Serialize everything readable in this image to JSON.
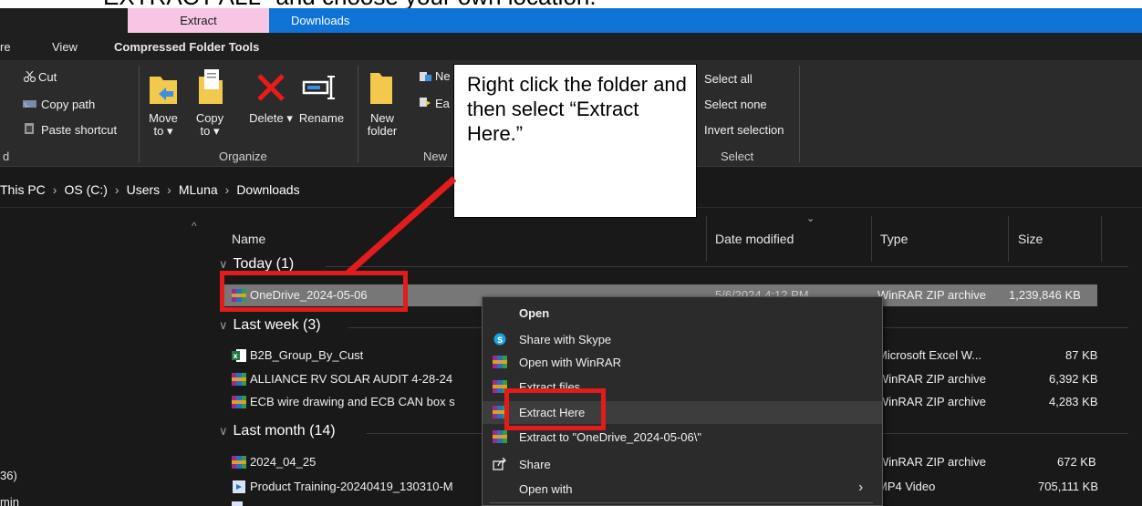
{
  "caption_top": "EXTRACT ALL\" and choose your own location.",
  "title_bar": {
    "context_tab": "Extract",
    "window_title": "Downloads"
  },
  "tabs": [
    {
      "label": "re"
    },
    {
      "label": "View"
    },
    {
      "label": "Compressed Folder Tools"
    }
  ],
  "ribbon": {
    "clipboard": {
      "cut": "Cut",
      "copy_path": "Copy path",
      "paste_shortcut": "Paste shortcut",
      "group_label": "d"
    },
    "organize": {
      "move_to": "Move to ▾",
      "copy_to": "Copy to ▾",
      "delete": "Delete ▾",
      "rename": "Rename",
      "group_label": "Organize"
    },
    "new": {
      "new_folder": "New folder",
      "new_item": "Ne",
      "easy_access": "Ea",
      "group_label": "New"
    },
    "select": {
      "select_all": "Select all",
      "select_none": "Select none",
      "invert": "Invert selection",
      "group_label": "Select"
    }
  },
  "address": {
    "crumbs": [
      "This PC",
      "OS (C:)",
      "Users",
      "MLuna",
      "Downloads"
    ]
  },
  "columns": {
    "name": "Name",
    "date": "Date modified",
    "type": "Type",
    "size": "Size"
  },
  "groups": [
    {
      "label": "Today (1)"
    },
    {
      "label": "Last week (3)"
    },
    {
      "label": "Last month (14)"
    }
  ],
  "files": [
    {
      "name": "OneDrive_2024-05-06",
      "date": "5/6/2024 4:12 PM",
      "type": "WinRAR ZIP archive",
      "size": "1,239,846 KB",
      "icon": "winrar-icon"
    },
    {
      "name": "B2B_Group_By_Cust",
      "date": "",
      "type": "Microsoft Excel W...",
      "size": "87 KB",
      "icon": "excel-icon"
    },
    {
      "name": "ALLIANCE RV SOLAR AUDIT 4-28-24",
      "date": "",
      "type": "WinRAR ZIP archive",
      "size": "6,392 KB",
      "icon": "winrar-icon"
    },
    {
      "name": "ECB wire drawing and ECB CAN box s",
      "date": "",
      "type": "WinRAR ZIP archive",
      "size": "4,283 KB",
      "icon": "winrar-icon"
    },
    {
      "name": "2024_04_25",
      "date": "",
      "type": "WinRAR ZIP archive",
      "size": "672 KB",
      "icon": "winrar-icon"
    },
    {
      "name": "Product Training-20240419_130310-M",
      "date": "",
      "type": "MP4 Video",
      "size": "705,111 KB",
      "icon": "video-icon"
    }
  ],
  "nav_fragments": [
    "36)",
    "min"
  ],
  "context_menu": {
    "items": [
      {
        "label": "Open",
        "icon": ""
      },
      {
        "label": "Share with Skype",
        "icon": "skype-icon"
      },
      {
        "label": "Open with WinRAR",
        "icon": "winrar-icon"
      },
      {
        "label": "Extract files...",
        "icon": "winrar-icon"
      },
      {
        "label": "Extract Here",
        "icon": "winrar-icon"
      },
      {
        "label": "Extract to \"OneDrive_2024-05-06\\\"",
        "icon": "winrar-icon"
      },
      {
        "label": "Share",
        "icon": "share-icon"
      },
      {
        "label": "Open with",
        "icon": ""
      }
    ]
  },
  "callout": {
    "text": "Right click the folder and then select “Extract Here.”"
  },
  "colors": {
    "highlight": "#e21c1c",
    "title_blue": "#0e73d4",
    "context_pink": "#f7c6e4",
    "selected_row": "#777777"
  }
}
